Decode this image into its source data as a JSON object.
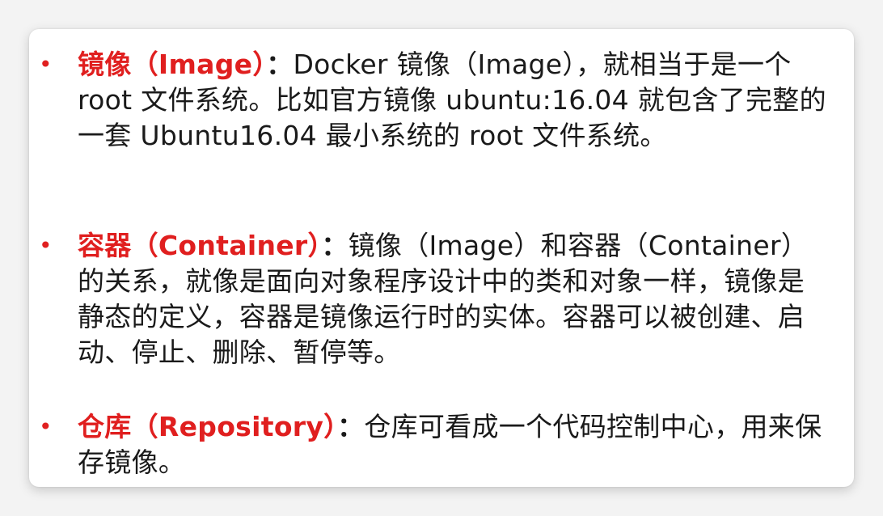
{
  "bullets": [
    {
      "symbol": "•",
      "term": "镜像（Image）",
      "separator": "：",
      "text": "Docker 镜像（Image），就相当于是一个 root 文件系统。比如官方镜像 ubuntu:16.04 就包含了完整的一套 Ubuntu16.04 最小系统的 root 文件系统。"
    },
    {
      "symbol": "•",
      "term": "容器（Container）",
      "separator": "：",
      "text": "镜像（Image）和容器（Container）的关系，就像是面向对象程序设计中的类和对象一样，镜像是静态的定义，容器是镜像运行时的实体。容器可以被创建、启动、停止、删除、暂停等。"
    },
    {
      "symbol": "•",
      "term": "仓库（Repository）",
      "separator": "：",
      "text": "仓库可看成一个代码控制中心，用来保存镜像。"
    }
  ],
  "colors": {
    "term": "#e01f1f",
    "bullet": "#e02020",
    "body_text": "#1a1a1a",
    "slide_bg": "#ffffff",
    "page_bg": "#f3f3f3"
  }
}
